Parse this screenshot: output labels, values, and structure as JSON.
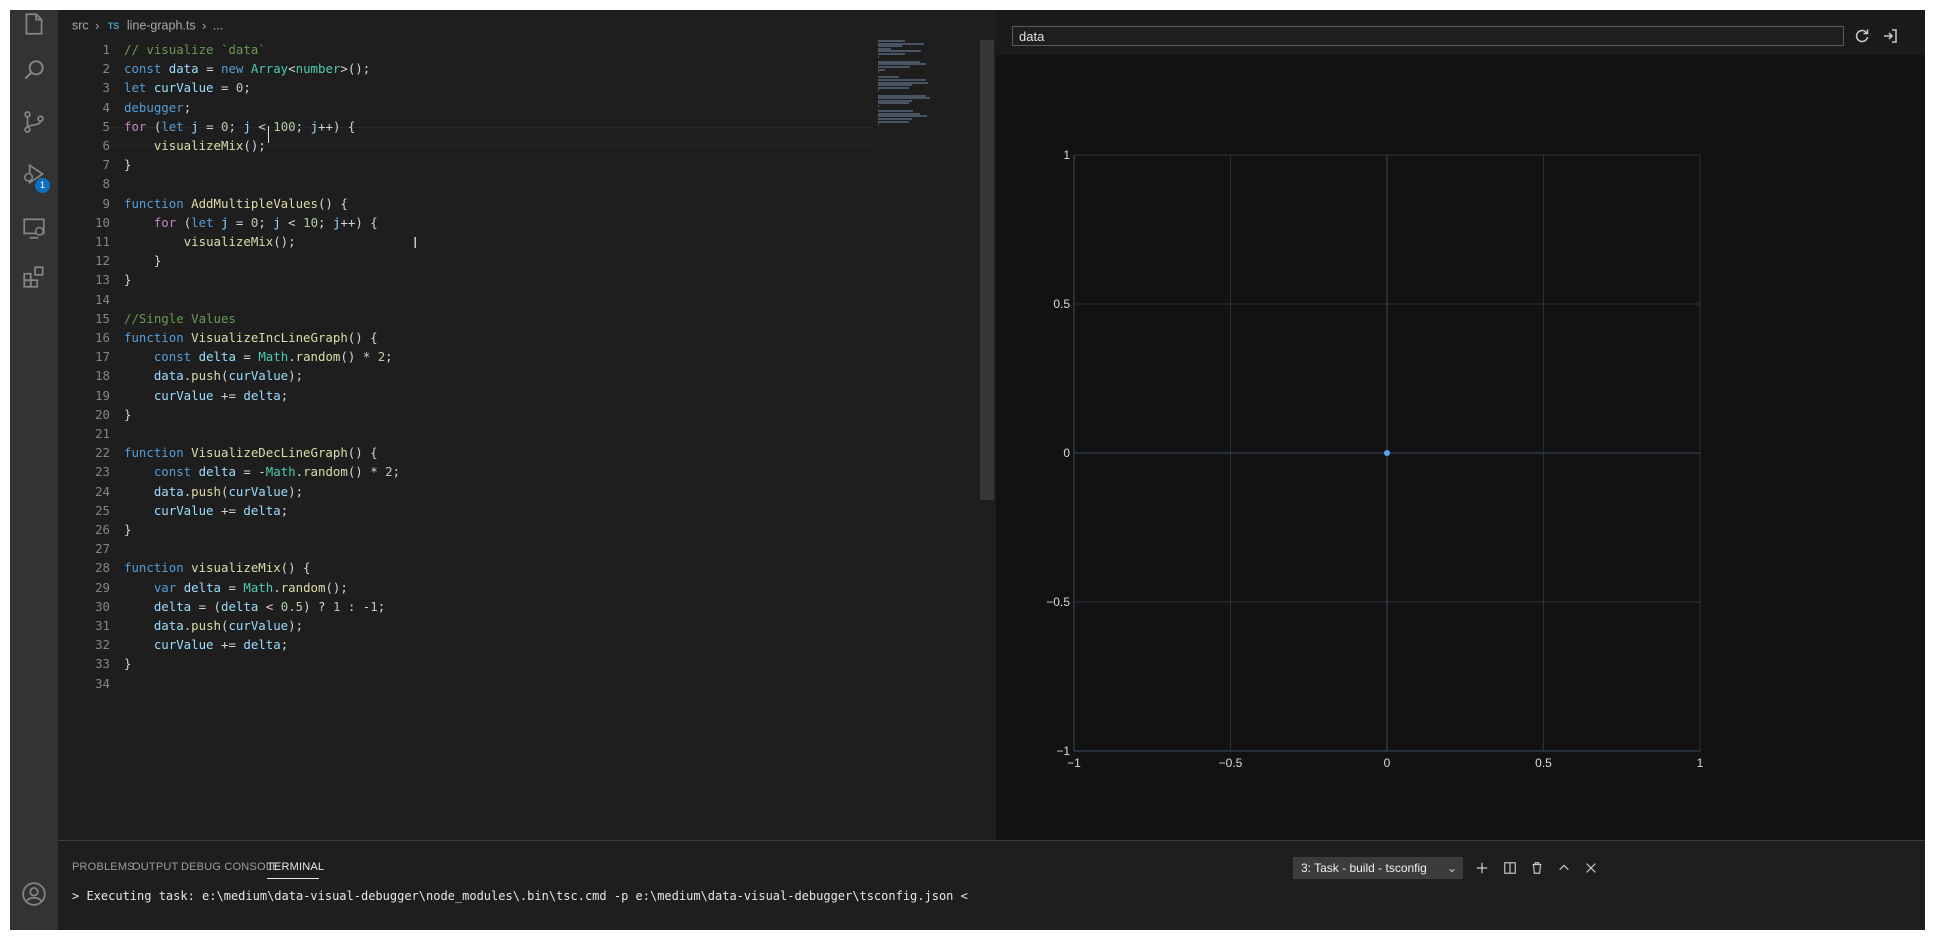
{
  "breadcrumb": {
    "folder": "src",
    "lang_badge": "TS",
    "file": "line-graph.ts",
    "more": "..."
  },
  "activity_bar": {
    "items": [
      "explorer-icon",
      "search-icon",
      "source-control-icon",
      "run-debug-icon",
      "remote-explorer-icon",
      "extensions-icon",
      "account-icon"
    ],
    "debug_badge": "1"
  },
  "code_lines": [
    [
      [
        "c",
        "// visualize `data`"
      ]
    ],
    [
      [
        "k",
        "const "
      ],
      [
        "v",
        "data"
      ],
      [
        "p",
        " = "
      ],
      [
        "k",
        "new "
      ],
      [
        "t",
        "Array"
      ],
      [
        "p",
        "<"
      ],
      [
        "t",
        "number"
      ],
      [
        "p",
        ">();"
      ]
    ],
    [
      [
        "k",
        "let "
      ],
      [
        "v",
        "curValue"
      ],
      [
        "p",
        " = "
      ],
      [
        "n",
        "0"
      ],
      [
        "p",
        ";"
      ]
    ],
    [
      [
        "k",
        "debugger"
      ],
      [
        "p",
        ";"
      ]
    ],
    [
      [
        "cf",
        "for "
      ],
      [
        "p",
        "("
      ],
      [
        "k",
        "let "
      ],
      [
        "v",
        "j"
      ],
      [
        "p",
        " = "
      ],
      [
        "n",
        "0"
      ],
      [
        "p",
        "; "
      ],
      [
        "v",
        "j"
      ],
      [
        "p",
        " < "
      ],
      [
        "n",
        "100"
      ],
      [
        "p",
        "; "
      ],
      [
        "v",
        "j"
      ],
      [
        "p",
        "++) {"
      ]
    ],
    [
      [
        "p",
        "    "
      ],
      [
        "f",
        "visualizeMix"
      ],
      [
        "p",
        "();"
      ]
    ],
    [
      [
        "p",
        "}"
      ]
    ],
    [],
    [
      [
        "k",
        "function "
      ],
      [
        "f",
        "AddMultipleValues"
      ],
      [
        "p",
        "() {"
      ]
    ],
    [
      [
        "p",
        "    "
      ],
      [
        "cf",
        "for "
      ],
      [
        "p",
        "("
      ],
      [
        "k",
        "let "
      ],
      [
        "v",
        "j"
      ],
      [
        "p",
        " = "
      ],
      [
        "n",
        "0"
      ],
      [
        "p",
        "; "
      ],
      [
        "v",
        "j"
      ],
      [
        "p",
        " < "
      ],
      [
        "n",
        "10"
      ],
      [
        "p",
        "; "
      ],
      [
        "v",
        "j"
      ],
      [
        "p",
        "++) {"
      ]
    ],
    [
      [
        "p",
        "        "
      ],
      [
        "f",
        "visualizeMix"
      ],
      [
        "p",
        "();"
      ]
    ],
    [
      [
        "p",
        "    }"
      ]
    ],
    [
      [
        "p",
        "}"
      ]
    ],
    [],
    [
      [
        "c",
        "//Single Values"
      ]
    ],
    [
      [
        "k",
        "function "
      ],
      [
        "f",
        "VisualizeIncLineGraph"
      ],
      [
        "p",
        "() {"
      ]
    ],
    [
      [
        "p",
        "    "
      ],
      [
        "k",
        "const "
      ],
      [
        "v",
        "delta"
      ],
      [
        "p",
        " = "
      ],
      [
        "t",
        "Math"
      ],
      [
        "p",
        "."
      ],
      [
        "f",
        "random"
      ],
      [
        "p",
        "() * "
      ],
      [
        "n",
        "2"
      ],
      [
        "p",
        ";"
      ]
    ],
    [
      [
        "p",
        "    "
      ],
      [
        "v",
        "data"
      ],
      [
        "p",
        "."
      ],
      [
        "f",
        "push"
      ],
      [
        "p",
        "("
      ],
      [
        "v",
        "curValue"
      ],
      [
        "p",
        ");"
      ]
    ],
    [
      [
        "p",
        "    "
      ],
      [
        "v",
        "curValue"
      ],
      [
        "p",
        " += "
      ],
      [
        "v",
        "delta"
      ],
      [
        "p",
        ";"
      ]
    ],
    [
      [
        "p",
        "}"
      ]
    ],
    [],
    [
      [
        "k",
        "function "
      ],
      [
        "f",
        "VisualizeDecLineGraph"
      ],
      [
        "p",
        "() {"
      ]
    ],
    [
      [
        "p",
        "    "
      ],
      [
        "k",
        "const "
      ],
      [
        "v",
        "delta"
      ],
      [
        "p",
        " = -"
      ],
      [
        "t",
        "Math"
      ],
      [
        "p",
        "."
      ],
      [
        "f",
        "random"
      ],
      [
        "p",
        "() * "
      ],
      [
        "n",
        "2"
      ],
      [
        "p",
        ";"
      ]
    ],
    [
      [
        "p",
        "    "
      ],
      [
        "v",
        "data"
      ],
      [
        "p",
        "."
      ],
      [
        "f",
        "push"
      ],
      [
        "p",
        "("
      ],
      [
        "v",
        "curValue"
      ],
      [
        "p",
        ");"
      ]
    ],
    [
      [
        "p",
        "    "
      ],
      [
        "v",
        "curValue"
      ],
      [
        "p",
        " += "
      ],
      [
        "v",
        "delta"
      ],
      [
        "p",
        ";"
      ]
    ],
    [
      [
        "p",
        "}"
      ]
    ],
    [],
    [
      [
        "k",
        "function "
      ],
      [
        "f",
        "visualizeMix"
      ],
      [
        "p",
        "() {"
      ]
    ],
    [
      [
        "p",
        "    "
      ],
      [
        "k",
        "var "
      ],
      [
        "v",
        "delta"
      ],
      [
        "p",
        " = "
      ],
      [
        "t",
        "Math"
      ],
      [
        "p",
        "."
      ],
      [
        "f",
        "random"
      ],
      [
        "p",
        "();"
      ]
    ],
    [
      [
        "p",
        "    "
      ],
      [
        "v",
        "delta"
      ],
      [
        "p",
        " = ("
      ],
      [
        "v",
        "delta"
      ],
      [
        "p",
        " < "
      ],
      [
        "n",
        "0.5"
      ],
      [
        "p",
        ") ? "
      ],
      [
        "n",
        "1"
      ],
      [
        "p",
        " : -"
      ],
      [
        "n",
        "1"
      ],
      [
        "p",
        ";"
      ]
    ],
    [
      [
        "p",
        "    "
      ],
      [
        "v",
        "data"
      ],
      [
        "p",
        "."
      ],
      [
        "f",
        "push"
      ],
      [
        "p",
        "("
      ],
      [
        "v",
        "curValue"
      ],
      [
        "p",
        ");"
      ]
    ],
    [
      [
        "p",
        "    "
      ],
      [
        "v",
        "curValue"
      ],
      [
        "p",
        " += "
      ],
      [
        "v",
        "delta"
      ],
      [
        "p",
        ";"
      ]
    ],
    [
      [
        "p",
        "}"
      ]
    ],
    []
  ],
  "webview": {
    "expression_value": "data",
    "refresh_icon": "refresh-icon",
    "open_icon": "open-in-panel-icon"
  },
  "chart_data": {
    "type": "scatter",
    "x": [
      0
    ],
    "y": [
      0
    ],
    "xlim": [
      -1,
      1
    ],
    "ylim": [
      -1,
      1
    ],
    "xticks": [
      "−1",
      "−0.5",
      "0",
      "0.5",
      "1"
    ],
    "yticks": [
      "1",
      "0.5",
      "0",
      "−0.5",
      "−1"
    ],
    "grid": true,
    "point_color": "#4fa3f7",
    "title": "",
    "xlabel": "",
    "ylabel": ""
  },
  "panel": {
    "tabs": [
      "PROBLEMS",
      "OUTPUT",
      "DEBUG CONSOLE",
      "TERMINAL"
    ],
    "active_tab": "TERMINAL",
    "task_select": "3: Task - build - tsconfig",
    "terminal_line": "> Executing task: e:\\medium\\data-visual-debugger\\node_modules\\.bin\\tsc.cmd -p e:\\medium\\data-visual-debugger\\tsconfig.json <"
  }
}
